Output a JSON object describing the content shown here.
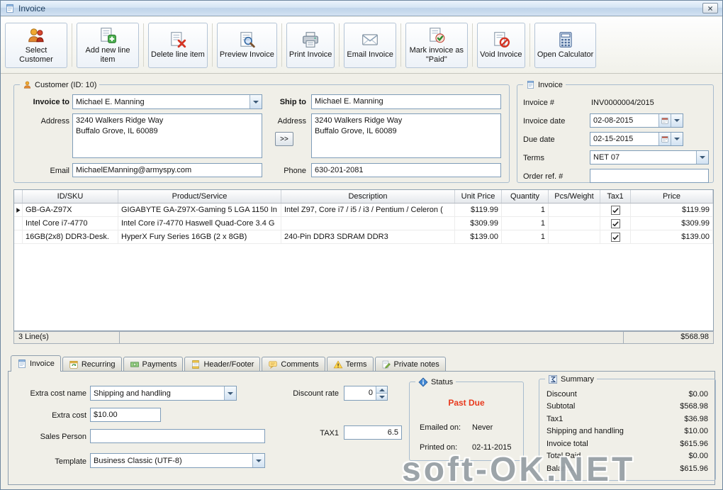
{
  "window": {
    "title": "Invoice"
  },
  "colors": {
    "past_due": "#e8391d",
    "accent_blue": "#3f86d2"
  },
  "toolbar": {
    "buttons": [
      {
        "id": "select-customer",
        "label": "Select Customer"
      },
      {
        "id": "add-line",
        "label": "Add new line item"
      },
      {
        "id": "delete-line",
        "label": "Delete line item"
      },
      {
        "id": "preview",
        "label": "Preview Invoice"
      },
      {
        "id": "print",
        "label": "Print Invoice"
      },
      {
        "id": "email",
        "label": "Email Invoice"
      },
      {
        "id": "mark-paid",
        "label": "Mark invoice as \"Paid\""
      },
      {
        "id": "void",
        "label": "Void Invoice"
      },
      {
        "id": "calculator",
        "label": "Open Calculator"
      }
    ]
  },
  "customer": {
    "group_title": "Customer (ID: 10)",
    "invoice_to_label": "Invoice to",
    "invoice_to_value": "Michael E. Manning",
    "address_label": "Address",
    "billing_address": "3240 Walkers Ridge Way\nBuffalo Grove, IL 60089",
    "email_label": "Email",
    "email_value": "MichaelEManning@armyspy.com",
    "ship_to_label": "Ship to",
    "ship_to_value": "Michael E. Manning",
    "ship_address_label": "Address",
    "copy_address_button": ">>",
    "shipping_address": "3240 Walkers Ridge Way\nBuffalo Grove, IL 60089",
    "phone_label": "Phone",
    "phone_value": "630-201-2081"
  },
  "invoice_info": {
    "group_title": "Invoice",
    "fields": [
      {
        "label": "Invoice #",
        "value": "INV0000004/2015",
        "type": "text"
      },
      {
        "label": "Invoice date",
        "value": "02-08-2015",
        "type": "date"
      },
      {
        "label": "Due date",
        "value": "02-15-2015",
        "type": "date"
      },
      {
        "label": "Terms",
        "value": "NET 07",
        "type": "select"
      },
      {
        "label": "Order ref. #",
        "value": "",
        "type": "input"
      }
    ]
  },
  "items": {
    "columns": [
      "",
      "ID/SKU",
      "Product/Service",
      "Description",
      "Unit Price",
      "Quantity",
      "Pcs/Weight",
      "Tax1",
      "Price"
    ],
    "rows": [
      {
        "sku": "GB-GA-Z97X",
        "product": "GIGABYTE GA-Z97X-Gaming 5 LGA 1150 In",
        "desc": "Intel Z97, Core i7 / i5 / i3 / Pentium / Celeron (",
        "unit": "$119.99",
        "qty": "1",
        "pcs": "",
        "tax1": true,
        "price": "$119.99"
      },
      {
        "sku": "Intel Core i7-4770",
        "product": "Intel Core i7-4770 Haswell Quad-Core 3.4 G",
        "desc": "",
        "unit": "$309.99",
        "qty": "1",
        "pcs": "",
        "tax1": true,
        "price": "$309.99"
      },
      {
        "sku": "16GB(2x8) DDR3-Desk.",
        "product": "HyperX Fury Series 16GB (2 x 8GB)",
        "desc": "240-Pin DDR3 SDRAM DDR3",
        "unit": "$139.00",
        "qty": "1",
        "pcs": "",
        "tax1": true,
        "price": "$139.00"
      }
    ],
    "line_count": "3 Line(s)",
    "lines_total": "$568.98"
  },
  "tabs": [
    {
      "id": "invoice",
      "label": "Invoice",
      "icon": "form-blue",
      "selected": true
    },
    {
      "id": "recurring",
      "label": "Recurring",
      "icon": "recurring",
      "selected": false
    },
    {
      "id": "payments",
      "label": "Payments",
      "icon": "payments",
      "selected": false
    },
    {
      "id": "header-footer",
      "label": "Header/Footer",
      "icon": "headerfooter",
      "selected": false
    },
    {
      "id": "comments",
      "label": "Comments",
      "icon": "comments",
      "selected": false
    },
    {
      "id": "terms",
      "label": "Terms",
      "icon": "warning",
      "selected": false
    },
    {
      "id": "private-notes",
      "label": "Private notes",
      "icon": "pencil",
      "selected": false
    }
  ],
  "details": {
    "extra_cost_name_label": "Extra cost name",
    "extra_cost_name_value": "Shipping and handling",
    "extra_cost_label": "Extra cost",
    "extra_cost_value": "$10.00",
    "sales_person_label": "Sales Person",
    "sales_person_value": "",
    "template_label": "Template",
    "template_value": "Business Classic (UTF-8)",
    "discount_rate_label": "Discount rate",
    "discount_rate_value": "0",
    "tax1_label": "TAX1",
    "tax1_value": "6.5"
  },
  "status": {
    "group_title": "Status",
    "state": "Past Due",
    "emailed_label": "Emailed on:",
    "emailed_value": "Never",
    "printed_label": "Printed on:",
    "printed_value": "02-11-2015"
  },
  "summary": {
    "group_title": "Summary",
    "rows": [
      {
        "label": "Discount",
        "value": "$0.00"
      },
      {
        "label": "Subtotal",
        "value": "$568.98"
      },
      {
        "label": "Tax1",
        "value": "$36.98"
      },
      {
        "label": "Shipping and handling",
        "value": "$10.00"
      },
      {
        "label": "Invoice total",
        "value": "$615.96"
      },
      {
        "label": "Total Paid",
        "value": "$0.00"
      },
      {
        "label": "Balance",
        "value": "$615.96"
      }
    ]
  },
  "watermark": "soft-OK.NET"
}
